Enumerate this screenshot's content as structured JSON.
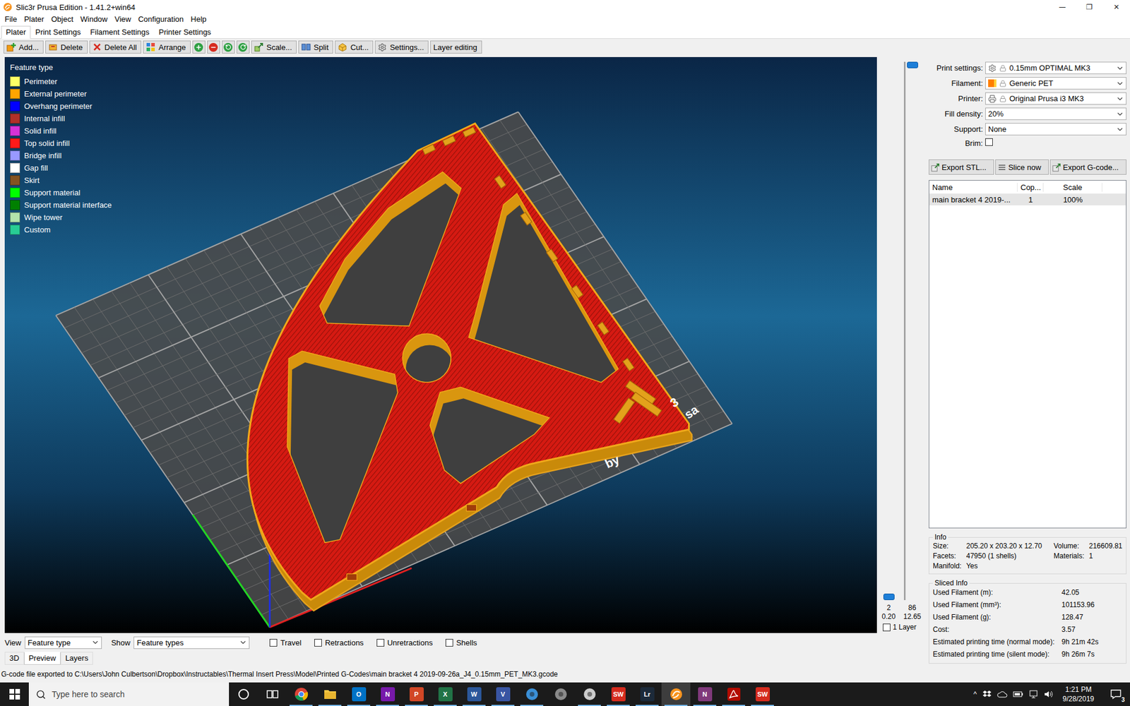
{
  "window": {
    "title": "Slic3r Prusa Edition - 1.41.2+win64",
    "controls": [
      "—",
      "❐",
      "✕"
    ]
  },
  "menu": [
    "File",
    "Plater",
    "Object",
    "Window",
    "View",
    "Configuration",
    "Help"
  ],
  "tabs": [
    {
      "label": "Plater",
      "selected": true
    },
    {
      "label": "Print Settings",
      "selected": false
    },
    {
      "label": "Filament Settings",
      "selected": false
    },
    {
      "label": "Printer Settings",
      "selected": false
    }
  ],
  "toolbar": [
    {
      "label": "Add...",
      "kind": "labeled"
    },
    {
      "label": "Delete",
      "kind": "labeled"
    },
    {
      "label": "Delete All",
      "kind": "labeled"
    },
    {
      "label": "Arrange",
      "kind": "labeled"
    },
    {
      "kind": "icon"
    },
    {
      "kind": "icon"
    },
    {
      "kind": "icon"
    },
    {
      "kind": "icon"
    },
    {
      "label": "Scale...",
      "kind": "labeled"
    },
    {
      "label": "Split",
      "kind": "labeled"
    },
    {
      "label": "Cut...",
      "kind": "labeled"
    },
    {
      "label": "Settings...",
      "kind": "labeled"
    },
    {
      "label": "Layer editing",
      "kind": "text"
    }
  ],
  "legend": {
    "title": "Feature type",
    "items": [
      {
        "label": "Perimeter",
        "color": "#ffff66"
      },
      {
        "label": "External perimeter",
        "color": "#ffa500"
      },
      {
        "label": "Overhang perimeter",
        "color": "#0000ff"
      },
      {
        "label": "Internal infill",
        "color": "#b03029"
      },
      {
        "label": "Solid infill",
        "color": "#d732d7"
      },
      {
        "label": "Top solid infill",
        "color": "#ff1a1a"
      },
      {
        "label": "Bridge infill",
        "color": "#9999ff"
      },
      {
        "label": "Gap fill",
        "color": "#ffffff"
      },
      {
        "label": "Skirt",
        "color": "#845321"
      },
      {
        "label": "Support material",
        "color": "#00ff00"
      },
      {
        "label": "Support material interface",
        "color": "#008000"
      },
      {
        "label": "Wipe tower",
        "color": "#b3e3ab"
      },
      {
        "label": "Custom",
        "color": "#28cc94"
      }
    ]
  },
  "bed_labels": [
    "3",
    "sa",
    "by"
  ],
  "layer_slider": {
    "upper": {
      "layer": "86",
      "height": "12.65",
      "level": 1
    },
    "lower": {
      "layer": "2",
      "height": "0.20",
      "level": 0
    },
    "one_layer": {
      "label": "1 Layer",
      "checked": false
    }
  },
  "view_bar": {
    "view_label": "View",
    "view_value": "Feature type",
    "show_label": "Show",
    "show_value": "Feature types",
    "options": [
      {
        "label": "Travel",
        "checked": false
      },
      {
        "label": "Retractions",
        "checked": false
      },
      {
        "label": "Unretractions",
        "checked": false
      },
      {
        "label": "Shells",
        "checked": false
      }
    ]
  },
  "view_tabs": [
    {
      "label": "3D",
      "selected": false
    },
    {
      "label": "Preview",
      "selected": true
    },
    {
      "label": "Layers",
      "selected": false
    }
  ],
  "settings": [
    {
      "label": "Print settings:",
      "value": "0.15mm OPTIMAL MK3",
      "kind": "preset"
    },
    {
      "label": "Filament:",
      "value": "Generic PET",
      "kind": "preset",
      "color": "#ff7f00"
    },
    {
      "label": "Printer:",
      "value": "Original Prusa i3 MK3",
      "kind": "preset"
    },
    {
      "label": "Fill density:",
      "value": "20%",
      "kind": "combo"
    },
    {
      "label": "Support:",
      "value": "None",
      "kind": "combo"
    },
    {
      "label": "Brim:",
      "kind": "checkbox",
      "checked": false
    }
  ],
  "actions": [
    "Export STL...",
    "Slice now",
    "Export G-code..."
  ],
  "object_list": {
    "columns": [
      "Name",
      "Cop...",
      "Scale"
    ],
    "rows": [
      {
        "cells": [
          "main bracket 4 2019-...",
          "1",
          "100%"
        ],
        "selected": true
      }
    ]
  },
  "info": {
    "title": "Info",
    "fields": [
      {
        "label": "Size:",
        "value": "205.20 x 203.20 x 12.70"
      },
      {
        "label": "Volume:",
        "value": "216609.81"
      },
      {
        "label": "Facets:",
        "value": "47950 (1 shells)"
      },
      {
        "label": "Materials:",
        "value": "1"
      },
      {
        "label": "Manifold:",
        "value": "Yes"
      }
    ]
  },
  "sliced_info": {
    "title": "Sliced Info",
    "fields": [
      {
        "label": "Used Filament (m):",
        "value": "42.05"
      },
      {
        "label": "Used Filament (mm³):",
        "value": "101153.96"
      },
      {
        "label": "Used Filament (g):",
        "value": "128.47"
      },
      {
        "label": "Cost:",
        "value": "3.57"
      },
      {
        "label": "Estimated printing time (normal mode):",
        "value": "9h 21m 42s"
      },
      {
        "label": "Estimated printing time (silent mode):",
        "value": "9h 26m 7s"
      }
    ]
  },
  "status_bar": "G-code file exported to C:\\Users\\John Culbertson\\Dropbox\\Instructables\\Thermal Insert Press\\Model\\Printed G-Codes\\main bracket 4 2019-09-26a_J4_0.15mm_PET_MK3.gcode",
  "taskbar": {
    "search_placeholder": "Type here to search",
    "apps": [
      {
        "kind": "ring",
        "color": "#ffffff",
        "glyph": "",
        "running": false,
        "active": false
      },
      {
        "kind": "taskview",
        "color": "#ffffff",
        "glyph": "",
        "running": false,
        "active": false
      },
      {
        "kind": "chrome",
        "color": "#4285f4",
        "glyph": "",
        "running": true,
        "active": false
      },
      {
        "kind": "folder",
        "color": "#f4c542",
        "glyph": "",
        "running": true,
        "active": false
      },
      {
        "kind": "tile",
        "color": "#0072c6",
        "glyph": "O",
        "running": true,
        "active": false
      },
      {
        "kind": "tile",
        "color": "#7719aa",
        "glyph": "N",
        "running": true,
        "active": false
      },
      {
        "kind": "tile",
        "color": "#d24726",
        "glyph": "P",
        "running": true,
        "active": false
      },
      {
        "kind": "tile",
        "color": "#217346",
        "glyph": "X",
        "running": true,
        "active": false
      },
      {
        "kind": "tile",
        "color": "#2b579a",
        "glyph": "W",
        "running": true,
        "active": false
      },
      {
        "kind": "tile",
        "color": "#3955a3",
        "glyph": "V",
        "running": true,
        "active": false
      },
      {
        "kind": "circle",
        "color": "#3a8fd6",
        "glyph": "",
        "running": true,
        "active": false
      },
      {
        "kind": "circle",
        "color": "#8a8a8a",
        "glyph": "",
        "running": false,
        "active": false
      },
      {
        "kind": "circle",
        "color": "#cccccc",
        "glyph": "",
        "running": true,
        "active": false
      },
      {
        "kind": "tile",
        "color": "#d52b1e",
        "glyph": "SW",
        "running": true,
        "active": false
      },
      {
        "kind": "tile",
        "color": "#1c2a3a",
        "glyph": "Lr",
        "running": true,
        "active": false
      },
      {
        "kind": "slic3r",
        "color": "#f7931e",
        "glyph": "",
        "running": true,
        "active": true
      },
      {
        "kind": "tile",
        "color": "#80397b",
        "glyph": "N",
        "running": true,
        "active": false
      },
      {
        "kind": "acrobat",
        "color": "#b30b00",
        "glyph": "",
        "running": true,
        "active": false
      },
      {
        "kind": "tile",
        "color": "#d52b1e",
        "glyph": "SW",
        "running": true,
        "active": false
      }
    ],
    "tray_expand": "^",
    "time": "1:21 PM",
    "date": "9/28/2019",
    "notifications": "3"
  }
}
